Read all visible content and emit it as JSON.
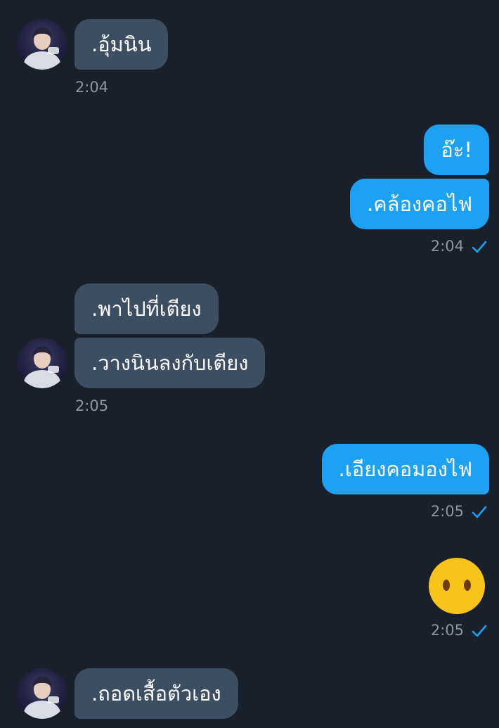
{
  "messages": [
    {
      "text": ".อุ้มนิน",
      "time": "2:04"
    },
    {
      "text": "อ๊ะ!"
    },
    {
      "text": ".คล้องคอไฟ",
      "time": "2:04"
    },
    {
      "text": ".พาไปที่เตียง"
    },
    {
      "text": ".วางนินลงกับเตียง",
      "time": "2:05"
    },
    {
      "text": ".เอียงคอมองไฟ",
      "time": "2:05"
    },
    {
      "emoji": "hushed-face-emoji",
      "time": "2:05"
    },
    {
      "text": ".ถอดเสื้อตัวเอง"
    }
  ],
  "icons": {
    "avatar": "avatar",
    "read_check": "check-icon"
  },
  "colors": {
    "background": "#17202b",
    "incoming_bubble": "#3c4e61",
    "outgoing_bubble": "#1da1f2",
    "timestamp": "#8b98a5",
    "check": "#1da1f2",
    "emoji": "#f9c41a"
  }
}
